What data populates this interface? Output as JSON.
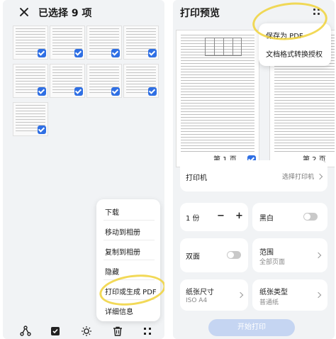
{
  "left": {
    "title": "已选择 9 项",
    "thumbnails_count": 9,
    "menu": {
      "items": [
        "下载",
        "移动到相册",
        "复制到相册",
        "隐藏",
        "打印或生成 PDF",
        "详细信息"
      ]
    },
    "bottom_icons": [
      "share-icon",
      "select-icon",
      "light-icon",
      "delete-icon",
      "more-icon"
    ]
  },
  "right": {
    "title": "打印预览",
    "pages": [
      {
        "label": "第 1 页",
        "selected": true
      },
      {
        "label": "第 2 页",
        "selected": false
      }
    ],
    "popup": {
      "items": [
        "保存为 PDF",
        "文档格式转换授权"
      ]
    },
    "printer": {
      "label": "打印机",
      "value": "选择打印机"
    },
    "copies": {
      "label": "1 份",
      "minus": "−",
      "plus": "+"
    },
    "bw": {
      "label": "黑白"
    },
    "duplex": {
      "label": "双面"
    },
    "range": {
      "label": "范围",
      "value": "全部页面"
    },
    "paper_size": {
      "label": "纸张尺寸",
      "value": "ISO A4"
    },
    "paper_type": {
      "label": "纸张类型",
      "value": "普通纸"
    },
    "start_button": "开始打印"
  },
  "colors": {
    "accent": "#2f6fe4",
    "highlight": "#f0d23a",
    "start_button_bg": "#c5d5f2"
  }
}
